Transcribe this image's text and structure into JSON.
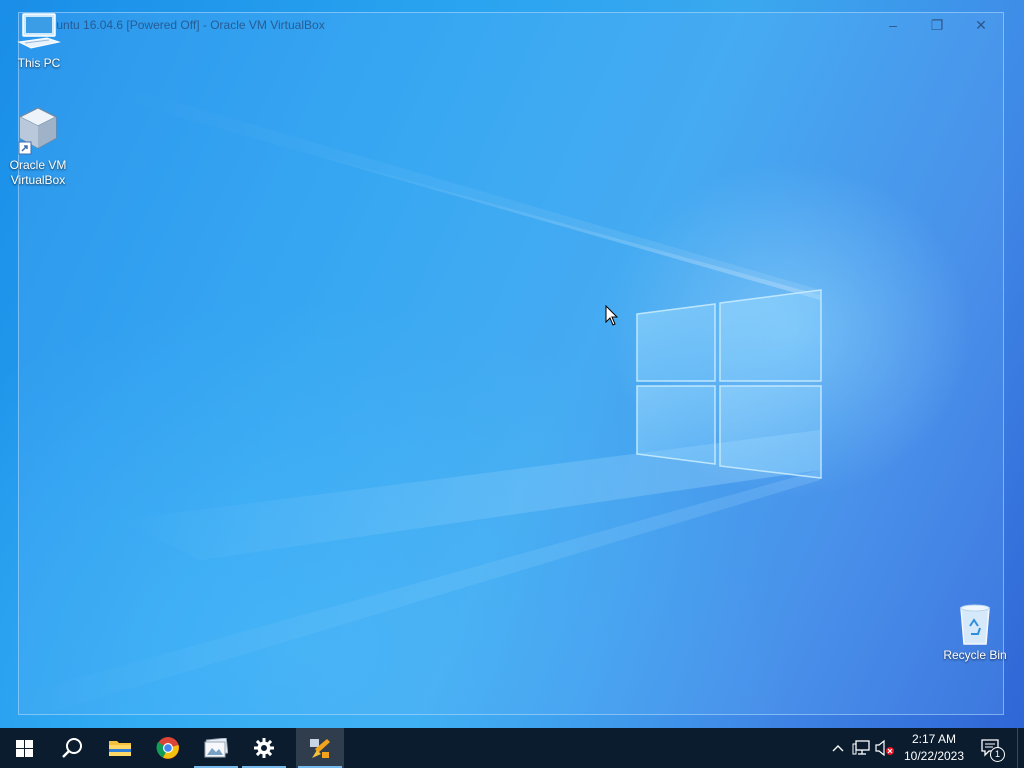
{
  "window": {
    "title": "Ubuntu 16.04.6 [Powered Off] - Oracle VM VirtualBox",
    "controls": {
      "minimize": "–",
      "restore": "❐",
      "close": "✕"
    }
  },
  "desktop_icons": [
    {
      "label": "This PC",
      "icon": "computer-icon"
    },
    {
      "label_line1": "Oracle VM",
      "label_line2": "VirtualBox",
      "icon": "virtualbox-icon"
    },
    {
      "label": "Recycle Bin",
      "icon": "recycle-bin-icon"
    }
  ],
  "taskbar": {
    "pinned": [
      {
        "name": "start",
        "icon": "windows-logo-icon"
      },
      {
        "name": "search",
        "icon": "search-icon"
      },
      {
        "name": "file-explorer",
        "icon": "folder-icon"
      },
      {
        "name": "chrome",
        "icon": "chrome-icon"
      },
      {
        "name": "photo-viewer",
        "icon": "photos-icon"
      },
      {
        "name": "settings",
        "icon": "gear-icon"
      },
      {
        "name": "virtualbox",
        "icon": "virtualbox-icon",
        "active": true
      }
    ],
    "tray": {
      "clock_time": "2:17 AM",
      "clock_date": "10/22/2023",
      "notification_count": "1"
    }
  },
  "colors": {
    "taskbar": "#0b1c2e",
    "accent": "#76b9ed",
    "desktop_blue": "#2aa4f0"
  }
}
